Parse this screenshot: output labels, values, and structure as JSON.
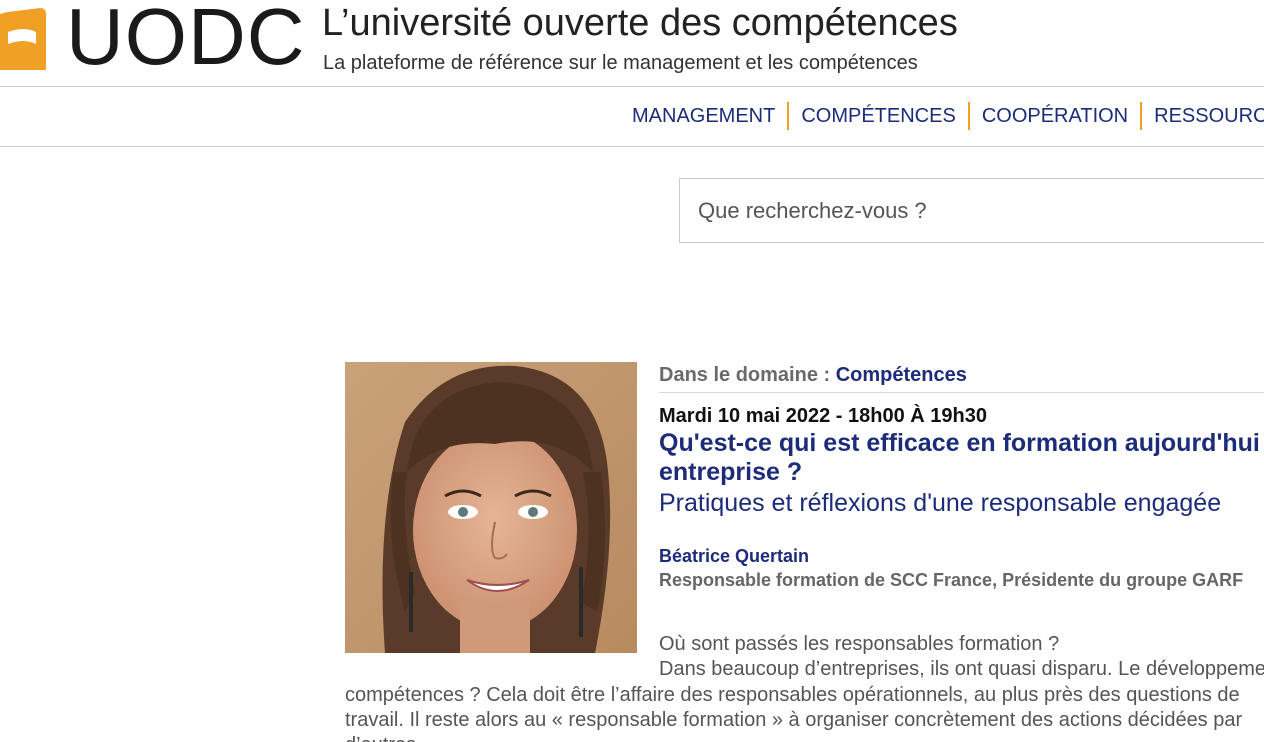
{
  "header": {
    "logo_text": "UODC",
    "site_title": "L’université ouverte des compétences",
    "tagline": "La plateforme de référence sur le management et les compétences"
  },
  "nav": {
    "items": [
      "MANAGEMENT",
      "COMPÉTENCES",
      "COOPÉRATION",
      "RESSOURCES"
    ]
  },
  "search": {
    "placeholder": "Que recherchez-vous ?"
  },
  "event": {
    "domain_label": "Dans le domaine :",
    "domain_value": "Compétences",
    "date": "Mardi 10 mai 2022 - 18h00 À 19h30",
    "title_line1": "Qu'est-ce qui est efficace en formation aujourd'hui en",
    "title_line2": "entreprise ?",
    "subtitle": "Pratiques et réflexions d'une responsable engagée",
    "speaker_name": "Béatrice Quertain",
    "speaker_role": "Responsable formation de SCC France, Présidente du groupe GARF",
    "body": [
      "Où sont passés les responsables formation ?",
      "Dans beaucoup d’entreprises, ils ont quasi disparu. Le développement des",
      "compétences ? Cela doit être l’affaire des responsables opérationnels, au plus près des questions de",
      "travail. Il reste alors au « responsable formation » à organiser concrètement des actions décidées par",
      "d’autres."
    ]
  },
  "colors": {
    "accent_orange": "#f0a025",
    "link_blue": "#1c2c7a"
  }
}
